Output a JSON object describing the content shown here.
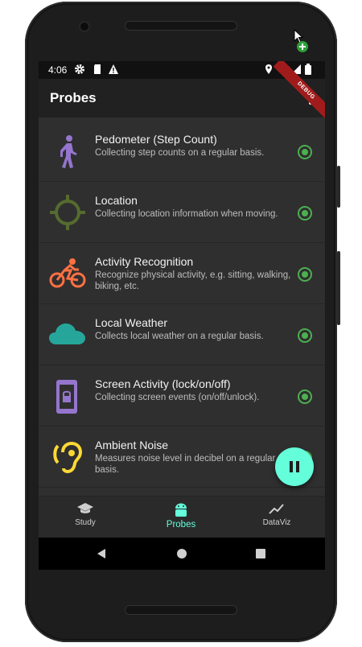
{
  "status_bar": {
    "time": "4:06"
  },
  "app_bar": {
    "title": "Probes",
    "debug_banner": "DEBUG"
  },
  "probes": [
    {
      "name": "Pedometer (Step Count)",
      "description": "Collecting step counts on a regular basis.",
      "icon": "walking-person-icon",
      "color": "#9575cd"
    },
    {
      "name": "Location",
      "description": "Collecting location information when moving.",
      "icon": "gps-crosshair-icon",
      "color": "#556b2f"
    },
    {
      "name": "Activity Recognition",
      "description": "Recognize physical activity, e.g. sitting, walking, biking, etc.",
      "icon": "cyclist-icon",
      "color": "#ff7043"
    },
    {
      "name": "Local Weather",
      "description": "Collects local weather on a regular basis.",
      "icon": "cloud-icon",
      "color": "#26a69a"
    },
    {
      "name": "Screen Activity (lock/on/off)",
      "description": "Collecting screen events (on/off/unlock).",
      "icon": "phone-lock-icon",
      "color": "#9575cd"
    },
    {
      "name": "Ambient Noise",
      "description": "Measures noise level in decibel on a regular basis.",
      "icon": "hearing-icon",
      "color": "#fdd835"
    }
  ],
  "bottom_nav": [
    {
      "label": "Study",
      "icon": "graduation-cap-icon"
    },
    {
      "label": "Probes",
      "icon": "android-icon",
      "active": true
    },
    {
      "label": "DataViz",
      "icon": "trending-line-icon"
    }
  ],
  "colors": {
    "accent": "#64ffda",
    "enabled": "#4caf50",
    "appbar": "#212121",
    "background": "#2f2f2f"
  }
}
